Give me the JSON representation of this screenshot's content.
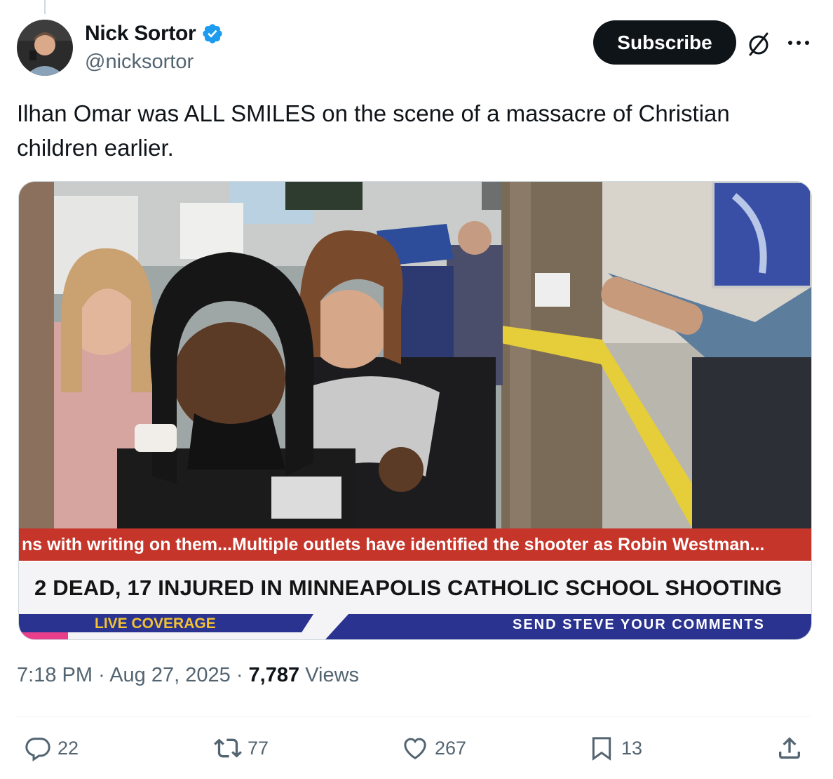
{
  "author": {
    "display_name": "Nick Sortor",
    "handle": "@nicksortor",
    "verified": true
  },
  "header": {
    "subscribe_label": "Subscribe",
    "icons": [
      "grok-icon",
      "more-icon"
    ]
  },
  "tweet": {
    "text": "Ilhan Omar was ALL SMILES on the scene of a massacre of Christian children earlier."
  },
  "media": {
    "ticker": "ns with writing on them...Multiple outlets have identified the shooter as Robin Westman...",
    "headline": "2 DEAD, 17 INJURED IN MINNEAPOLIS CATHOLIC SCHOOL SHOOTING",
    "live_label": "LIVE COVERAGE",
    "comments_label": "SEND STEVE YOUR COMMENTS",
    "colors": {
      "ticker": "#c6352a",
      "bar": "#2b3390",
      "live": "#f2c230"
    }
  },
  "meta": {
    "time": "7:18 PM",
    "separator": "·",
    "date": "Aug 27, 2025",
    "views_count": "7,787",
    "views_label": "Views"
  },
  "actions": {
    "replies": "22",
    "reposts": "77",
    "likes": "267",
    "bookmarks": "13"
  }
}
